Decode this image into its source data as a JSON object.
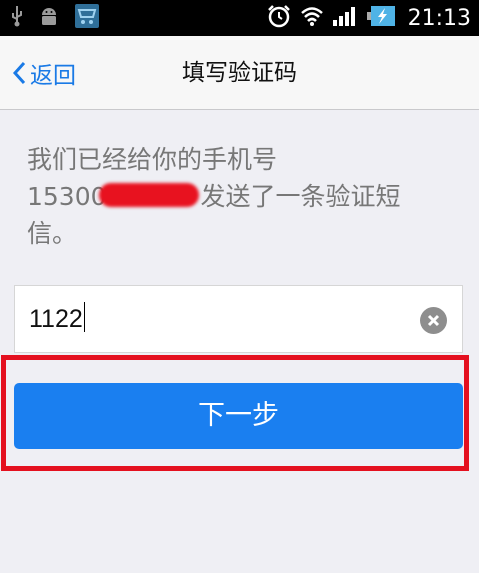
{
  "status_bar": {
    "time": "21:13",
    "icons": [
      "usb-icon",
      "android-debug-icon",
      "store-icon",
      "alarm-clock-icon",
      "wifi-icon",
      "signal-icon",
      "battery-charging-icon"
    ]
  },
  "nav": {
    "back_label": "返回",
    "title": "填写验证码"
  },
  "prompt": {
    "line1": "我们已经给你的手机号",
    "phone_visible": "15300",
    "line2_rest": "发送了一条验证短",
    "line3": "信。"
  },
  "code_input": {
    "value": "1122"
  },
  "next_button": {
    "label": "下一步"
  },
  "colors": {
    "accent": "#1a7ff0",
    "highlight": "#e4101f",
    "background": "#efeff4"
  }
}
